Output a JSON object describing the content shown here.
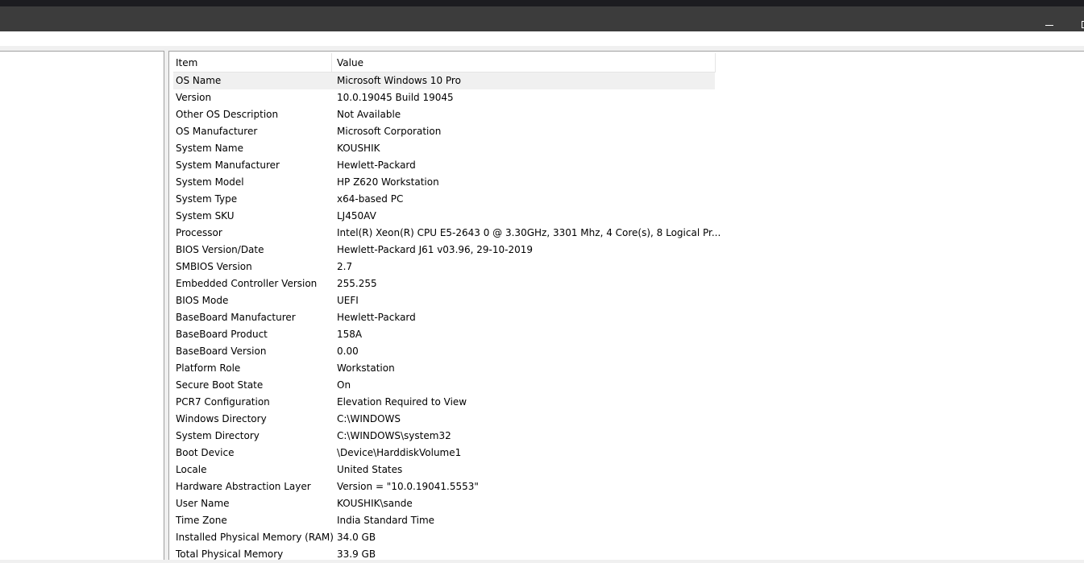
{
  "columns": {
    "item": "Item",
    "value": "Value"
  },
  "rows": [
    [
      "OS Name",
      "Microsoft Windows 10 Pro"
    ],
    [
      "Version",
      "10.0.19045 Build 19045"
    ],
    [
      "Other OS Description",
      "Not Available"
    ],
    [
      "OS Manufacturer",
      "Microsoft Corporation"
    ],
    [
      "System Name",
      "KOUSHIK"
    ],
    [
      "System Manufacturer",
      "Hewlett-Packard"
    ],
    [
      "System Model",
      "HP Z620 Workstation"
    ],
    [
      "System Type",
      "x64-based PC"
    ],
    [
      "System SKU",
      "LJ450AV"
    ],
    [
      "Processor",
      "Intel(R) Xeon(R) CPU E5-2643 0 @ 3.30GHz, 3301 Mhz, 4 Core(s), 8 Logical Pr..."
    ],
    [
      "BIOS Version/Date",
      "Hewlett-Packard J61 v03.96, 29-10-2019"
    ],
    [
      "SMBIOS Version",
      "2.7"
    ],
    [
      "Embedded Controller Version",
      "255.255"
    ],
    [
      "BIOS Mode",
      "UEFI"
    ],
    [
      "BaseBoard Manufacturer",
      "Hewlett-Packard"
    ],
    [
      "BaseBoard Product",
      "158A"
    ],
    [
      "BaseBoard Version",
      "0.00"
    ],
    [
      "Platform Role",
      "Workstation"
    ],
    [
      "Secure Boot State",
      "On"
    ],
    [
      "PCR7 Configuration",
      "Elevation Required to View"
    ],
    [
      "Windows Directory",
      "C:\\WINDOWS"
    ],
    [
      "System Directory",
      "C:\\WINDOWS\\system32"
    ],
    [
      "Boot Device",
      "\\Device\\HarddiskVolume1"
    ],
    [
      "Locale",
      "United States"
    ],
    [
      "Hardware Abstraction Layer",
      "Version = \"10.0.19041.5553\""
    ],
    [
      "User Name",
      "KOUSHIK\\sande"
    ],
    [
      "Time Zone",
      "India Standard Time"
    ],
    [
      "Installed Physical Memory (RAM)",
      "34.0 GB"
    ],
    [
      "Total Physical Memory",
      "33.9 GB"
    ]
  ]
}
